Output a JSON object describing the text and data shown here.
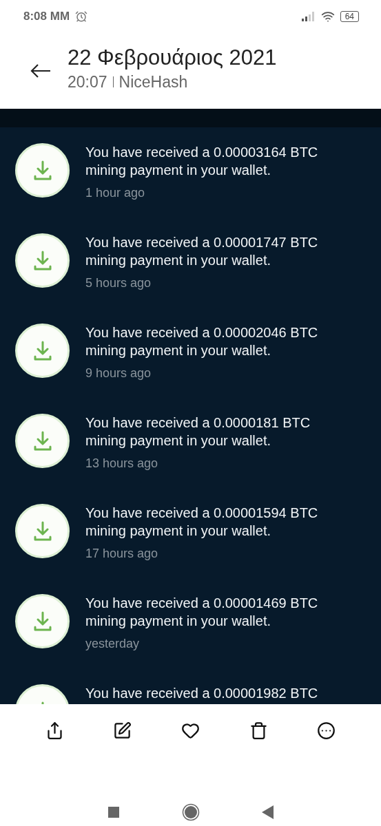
{
  "status_bar": {
    "time": "8:08 MM",
    "battery": "64"
  },
  "header": {
    "title": "22 Φεβρουάριος 2021",
    "time": "20:07",
    "source": "NiceHash"
  },
  "notifications": [
    {
      "message": "You have received a 0.00003164 BTC mining payment in your wallet.",
      "time": "1 hour ago"
    },
    {
      "message": "You have received a 0.00001747 BTC mining payment in your wallet.",
      "time": "5 hours ago"
    },
    {
      "message": "You have received a 0.00002046 BTC mining payment in your wallet.",
      "time": "9 hours ago"
    },
    {
      "message": "You have received a 0.0000181 BTC mining payment in your wallet.",
      "time": "13 hours ago"
    },
    {
      "message": "You have received a 0.00001594 BTC mining payment in your wallet.",
      "time": "17 hours ago"
    },
    {
      "message": "You have received a 0.00001469 BTC mining payment in your wallet.",
      "time": "yesterday"
    },
    {
      "message": "You have received a 0.00001982 BTC"
    }
  ],
  "toolbar": [
    {
      "kind": "share"
    },
    {
      "kind": "edit"
    },
    {
      "kind": "favorite"
    },
    {
      "kind": "delete"
    },
    {
      "kind": "more"
    }
  ],
  "nav_bar": [
    {
      "kind": "recents"
    },
    {
      "kind": "home"
    },
    {
      "kind": "back"
    }
  ]
}
